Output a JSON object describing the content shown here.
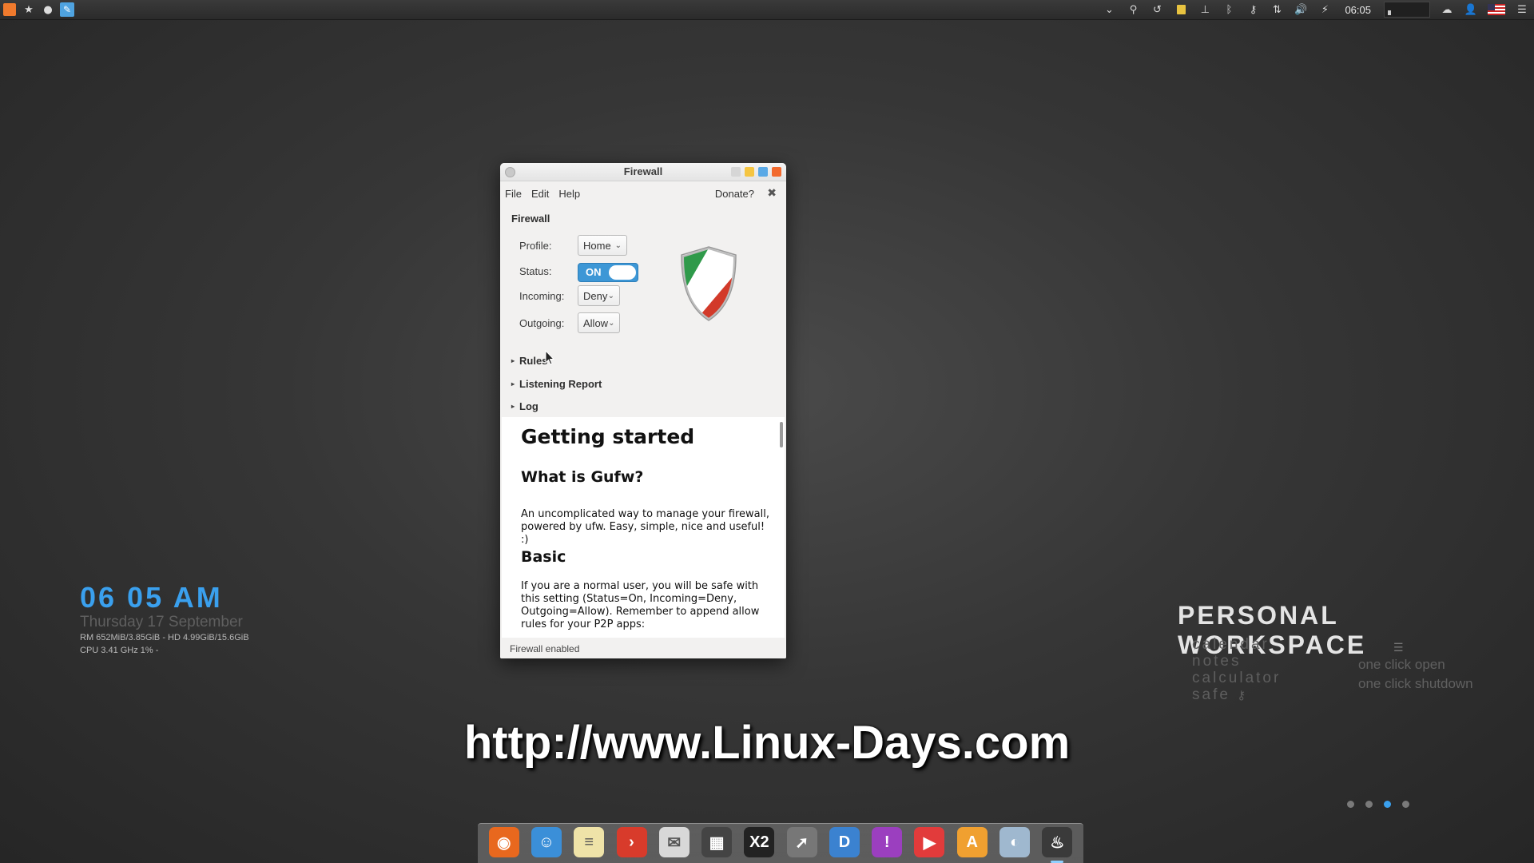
{
  "top_panel": {
    "left_icons": [
      "app-launcher-icon",
      "favorites-star-icon",
      "circle-indicator-icon",
      "active-app-icon"
    ],
    "tray_icons": [
      "chevron-down-icon",
      "search-icon",
      "history-icon",
      "notes-icon",
      "network-icon",
      "bluetooth-icon",
      "key-icon",
      "transfer-arrows-icon",
      "volume-icon",
      "power-icon"
    ],
    "clock": "06:05",
    "after_clock_icons": [
      "memory-graph-icon",
      "cloud-icon",
      "user-icon",
      "us-flag-icon",
      "menu-icon"
    ]
  },
  "window": {
    "title": "Firewall",
    "menu": {
      "file": "File",
      "edit": "Edit",
      "help": "Help",
      "donate": "Donate?"
    },
    "firewall": {
      "heading": "Firewall",
      "profile_label": "Profile:",
      "profile_value": "Home",
      "status_label": "Status:",
      "status_value": "ON",
      "incoming_label": "Incoming:",
      "incoming_value": "Deny",
      "outgoing_label": "Outgoing:",
      "outgoing_value": "Allow"
    },
    "expanders": {
      "rules": "Rules",
      "listening": "Listening Report",
      "log": "Log"
    },
    "help": {
      "h1": "Getting started",
      "h2_what": "What is Gufw?",
      "p_what": "An uncomplicated way to manage your firewall, powered by ufw. Easy, simple, nice and useful! :)",
      "h2_basic": "Basic",
      "p_basic": "If you are a normal user, you will be safe with this setting (Status=On, Incoming=Deny, Outgoing=Allow). Remember to append allow rules for your P2P apps:"
    },
    "statusbar": "Firewall enabled",
    "colors": {
      "toggle_on": "#3d97d6",
      "shield_green": "#2f9a4a",
      "shield_red": "#d23a2a",
      "btn_yellow": "#f5c542",
      "btn_blue": "#5aa9e6",
      "btn_orange": "#f26a2e"
    }
  },
  "clock_widget": {
    "time": "06 05 AM",
    "date": "Thursday 17 September",
    "stats_1": "RM 652MiB/3.85GiB - HD 4.99GiB/15.6GiB",
    "stats_2": "CPU 3.41 GHz 1% -"
  },
  "workspace_widget": {
    "title": "PERSONAL WORKSPACE",
    "items": [
      "calendar",
      "notes",
      "calculator",
      "safe"
    ],
    "hint_1": "one click open",
    "hint_2": "one click shutdown"
  },
  "watermark": "http://www.Linux-Days.com",
  "workspace_dots": {
    "count": 4,
    "active_index": 2
  },
  "dock": {
    "items": [
      {
        "name": "firefox",
        "icon": "firefox-icon",
        "color": "#e8681e",
        "glyph": "◉"
      },
      {
        "name": "finder",
        "icon": "file-manager-icon",
        "color": "#3b8fd8",
        "glyph": "☺"
      },
      {
        "name": "notes",
        "icon": "notepad-icon",
        "color": "#efe3a8",
        "glyph": "≡"
      },
      {
        "name": "terminal",
        "icon": "terminal-icon",
        "color": "#d83b2b",
        "glyph": "›"
      },
      {
        "name": "mail",
        "icon": "mail-icon",
        "color": "#d8d8d8",
        "glyph": "✉"
      },
      {
        "name": "widgets",
        "icon": "dashboard-icon",
        "color": "#444444",
        "glyph": "▦"
      },
      {
        "name": "x2",
        "icon": "x2-app-icon",
        "color": "#222222",
        "glyph": "X2"
      },
      {
        "name": "launcher",
        "icon": "rocket-icon",
        "color": "#777777",
        "glyph": "➚"
      },
      {
        "name": "docs",
        "icon": "document-viewer-icon",
        "color": "#3b82d0",
        "glyph": "D"
      },
      {
        "name": "chat",
        "icon": "chat-bubble-icon",
        "color": "#9b3fbf",
        "glyph": "!"
      },
      {
        "name": "youtube",
        "icon": "youtube-icon",
        "color": "#e23b3b",
        "glyph": "▶"
      },
      {
        "name": "store",
        "icon": "software-center-icon",
        "color": "#f0a030",
        "glyph": "A"
      },
      {
        "name": "settings",
        "icon": "settings-switch-icon",
        "color": "#9fb8cf",
        "glyph": "◐"
      },
      {
        "name": "firewall",
        "icon": "flame-icon",
        "color": "#3a3a3a",
        "glyph": "♨",
        "running": true
      }
    ]
  }
}
